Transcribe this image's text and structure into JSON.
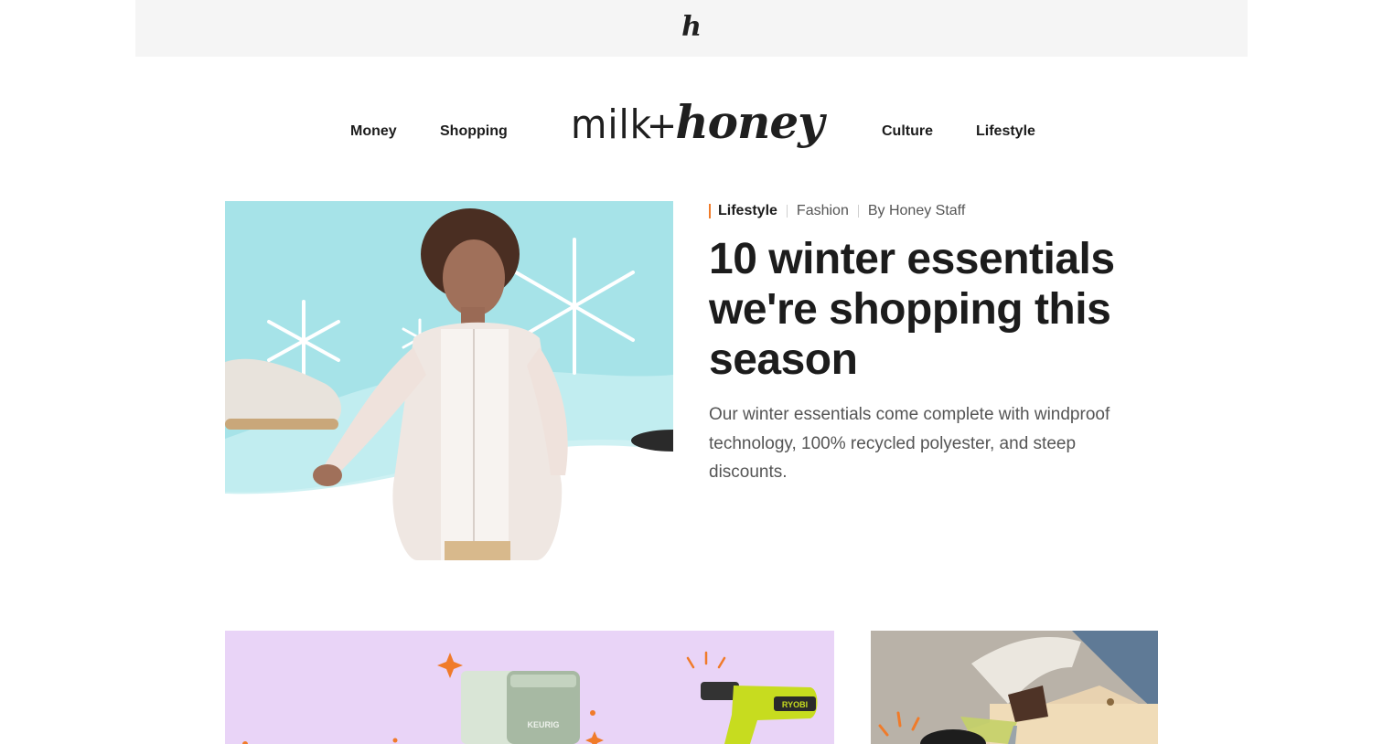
{
  "topbar": {
    "logo_letter": "h",
    "logo_icon": "honey-h-logo"
  },
  "nav": {
    "left": [
      "Money",
      "Shopping"
    ],
    "right": [
      "Culture",
      "Lifestyle"
    ],
    "brand": {
      "part1": "milk",
      "plus": "+",
      "part2": "honey"
    }
  },
  "hero": {
    "category": "Lifestyle",
    "subcategory": "Fashion",
    "author": "By Honey Staff",
    "title": "10 winter essentials we're shopping this season",
    "summary": "Our winter essentials come complete with windproof technology, 100% recycled polyester, and steep discounts.",
    "image": "winter-fashion-photo",
    "accent_color": "#f07b2a"
  },
  "cards": [
    {
      "image": "keurig-and-drill-photo",
      "product_text_1": "KEURIG",
      "product_text_2": "RYOBI",
      "background": "#e9d4f7"
    },
    {
      "image": "diy-sanding-photo"
    }
  ]
}
